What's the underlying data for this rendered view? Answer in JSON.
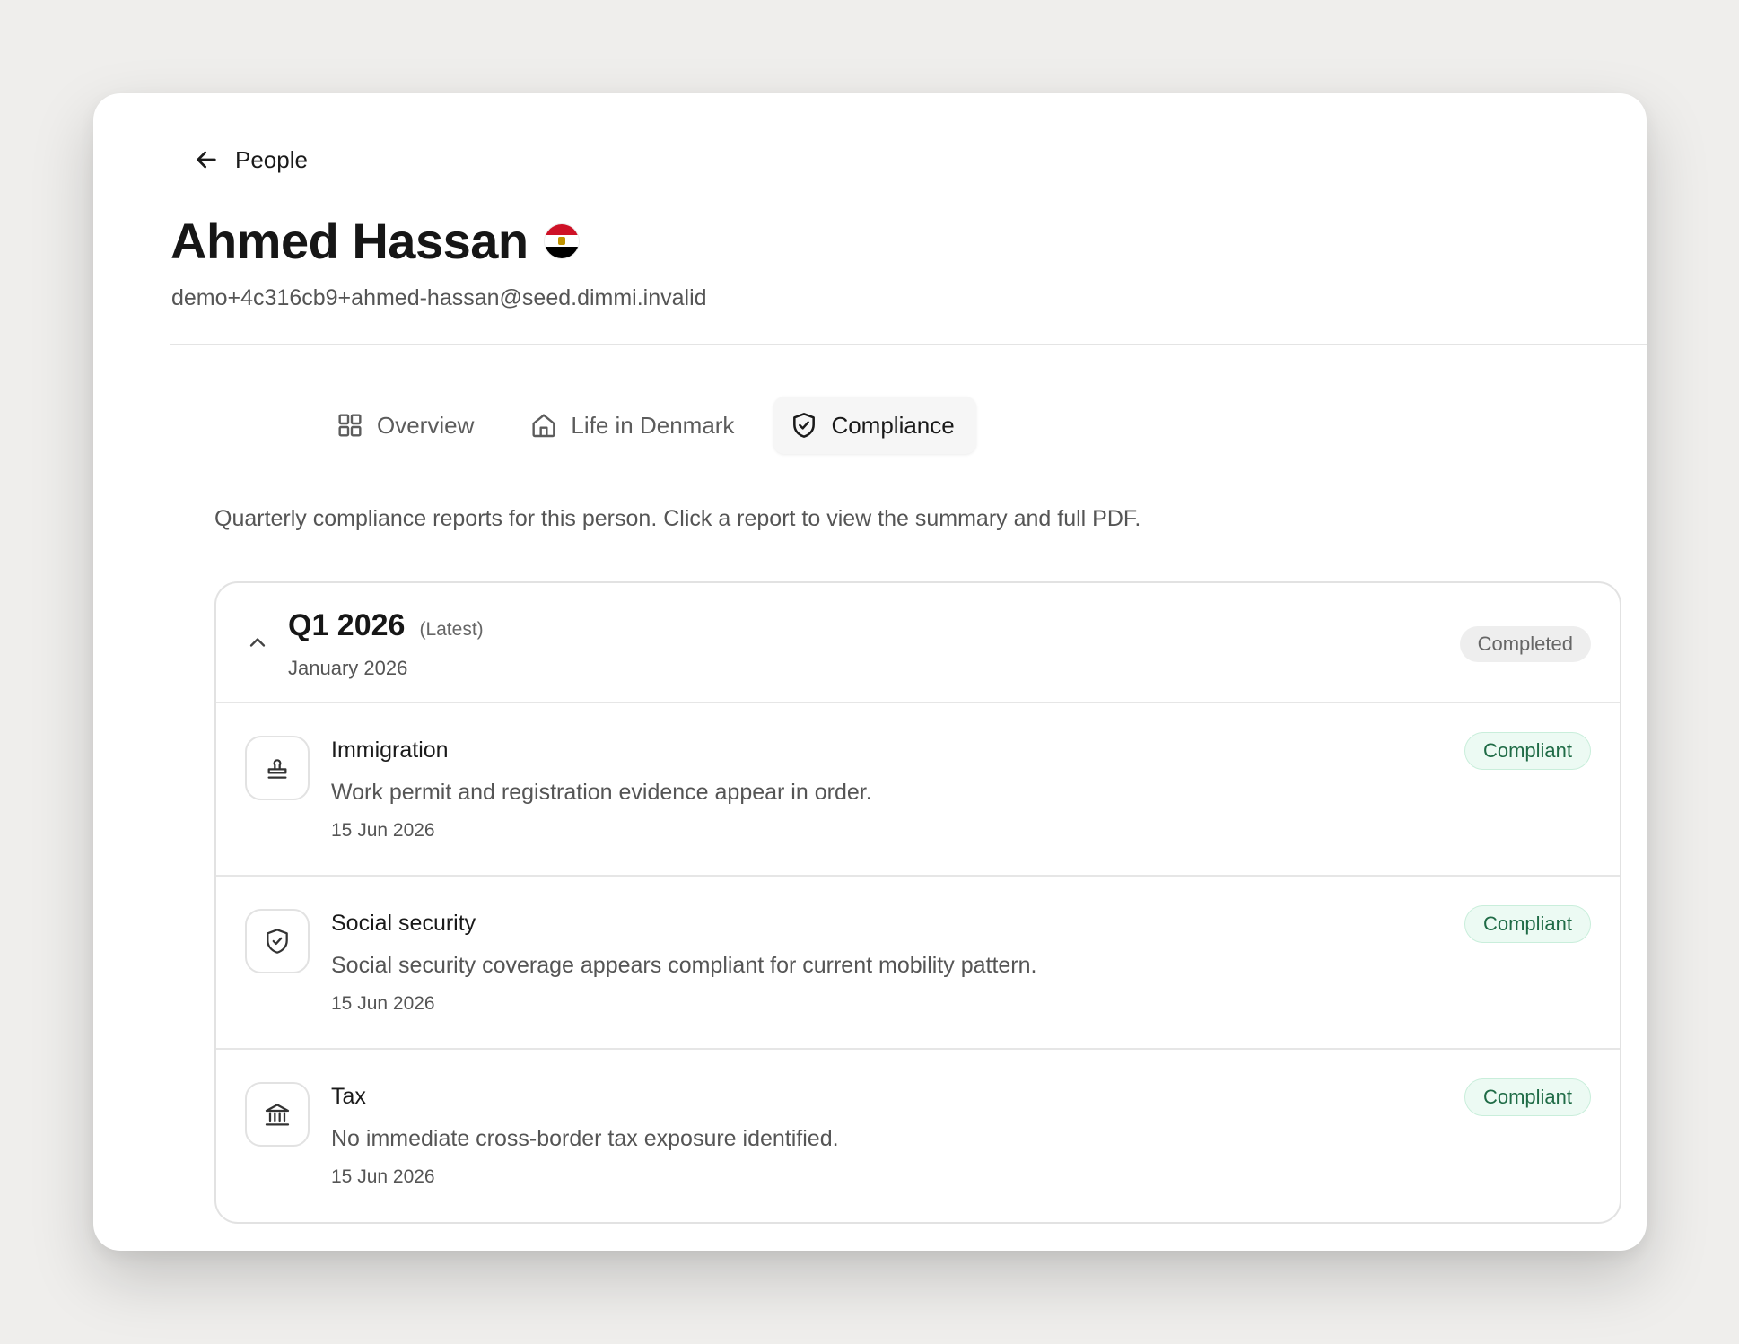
{
  "nav": {
    "back_label": "People"
  },
  "person": {
    "name": "Ahmed Hassan",
    "email": "demo+4c316cb9+ahmed-hassan@seed.dimmi.invalid",
    "flag_icon": "egypt-flag-icon"
  },
  "tabs": [
    {
      "label": "Overview",
      "icon": "grid-icon",
      "active": false
    },
    {
      "label": "Life in Denmark",
      "icon": "home-icon",
      "active": false
    },
    {
      "label": "Compliance",
      "icon": "shield-check-icon",
      "active": true
    }
  ],
  "intro": "Quarterly compliance reports for this person. Click a report to view the summary and full PDF.",
  "report": {
    "quarter": "Q1 2026",
    "latest_tag": "(Latest)",
    "period": "January 2026",
    "status": "Completed",
    "items": [
      {
        "title": "Immigration",
        "description": "Work permit and registration evidence appear in order.",
        "date": "15 Jun 2026",
        "status": "Compliant",
        "icon": "stamp-icon"
      },
      {
        "title": "Social security",
        "description": "Social security coverage appears compliant for current mobility pattern.",
        "date": "15 Jun 2026",
        "status": "Compliant",
        "icon": "shield-check-icon"
      },
      {
        "title": "Tax",
        "description": "No immediate cross-border tax exposure identified.",
        "date": "15 Jun 2026",
        "status": "Compliant",
        "icon": "bank-icon"
      }
    ]
  },
  "colors": {
    "compliant_text": "#1f6b46",
    "compliant_bg": "#ecfaf3",
    "completed_bg": "#eeeeee"
  }
}
